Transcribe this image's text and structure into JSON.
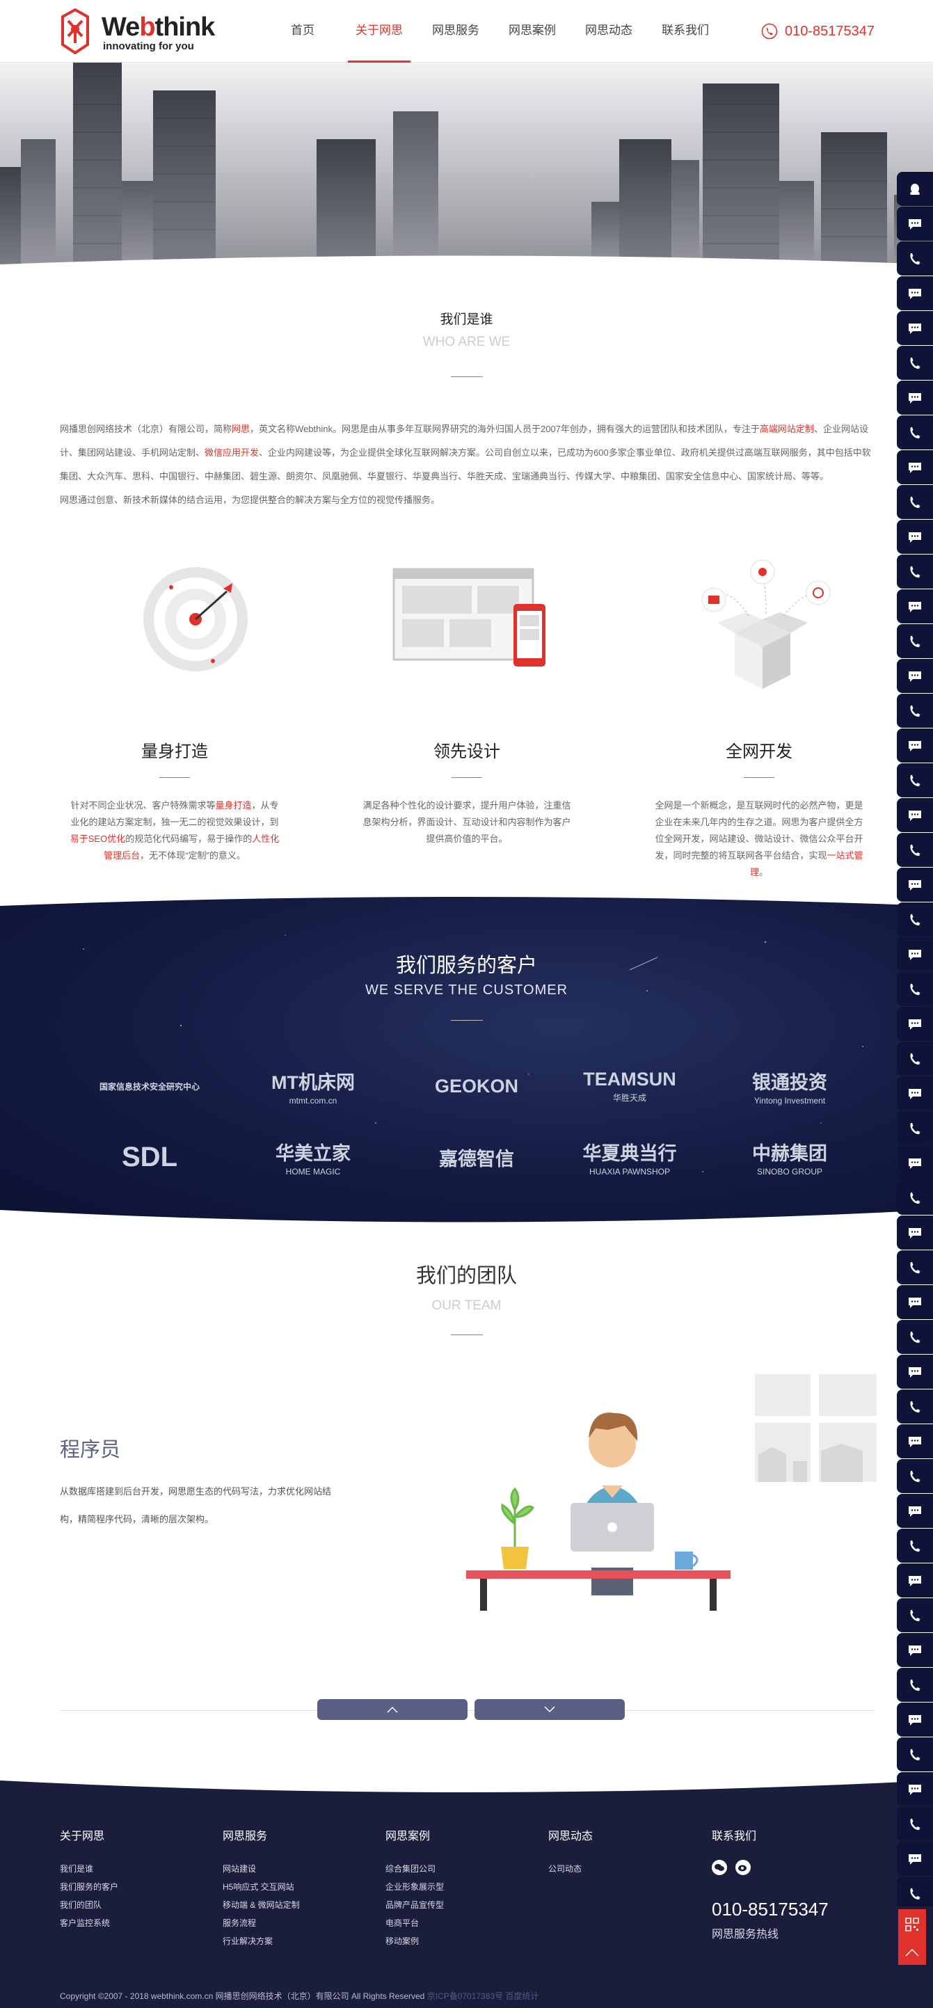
{
  "header": {
    "logo_name": "Webthink",
    "logo_slogan": "innovating for you",
    "nav": [
      "首页",
      "关于网思",
      "网思服务",
      "网思案例",
      "网思动态",
      "联系我们"
    ],
    "active_nav_index": 1,
    "phone": "010-85175347"
  },
  "who": {
    "title_cn": "我们是谁",
    "title_en": "WHO ARE WE",
    "para1": [
      {
        "t": "网播思创网络技术（北京）有限公司，简称"
      },
      {
        "t": "网思",
        "hl": true
      },
      {
        "t": "，英文名称Webthink。网思是由从事多年互联网界研究的海外归国人员于2007年创办，拥有强大的运营团队和技术团队，专注于"
      },
      {
        "t": "高端网站定制",
        "hl": true
      },
      {
        "t": "、企业网站设计、集团网站建设、手机网站定制、"
      },
      {
        "t": "微信应用开发",
        "hl": true
      },
      {
        "t": "、企业内网建设等，为企业提供全球化互联网解决方案。公司自创立以来，已成功为600多家企事业单位、政府机关提供过高端互联网服务，其中包括中软集团、大众汽车、思科、中国银行、中赫集团、碧生源、朗资尔、凤凰驰佩、华夏银行、华夏典当行、华胜天成、宝瑞通典当行、传媒大学、中粮集团、国家安全信息中心、国家统计局、等等。"
      }
    ],
    "para2": "网思通过创意、新技术新媒体的结合运用，为您提供整合的解决方案与全方位的视觉传播服务。"
  },
  "features": [
    {
      "title": "量身打造",
      "desc": [
        {
          "t": "针对不同企业状况、客户特殊需求等"
        },
        {
          "t": "量身打造",
          "hl": true
        },
        {
          "t": "，从专业化的建站方案定制，独一无二的视觉效果设计，到"
        },
        {
          "t": "易于SEO优化",
          "hl": true
        },
        {
          "t": "的规范化代码编写，易于操作的"
        },
        {
          "t": "人性化管理后台",
          "hl": true
        },
        {
          "t": "，无不体现“定制”的意义。"
        }
      ]
    },
    {
      "title": "领先设计",
      "desc": [
        {
          "t": "满足各种个性化的设计要求，提升用户体验，注重信息架构分析，界面设计、互动设计和内容制作为客户提供高价值的平台。"
        }
      ]
    },
    {
      "title": "全网开发",
      "desc": [
        {
          "t": "全网是一个新概念，是互联网时代的必然产物，更是企业在未来几年内的生存之道。网思为客户提供全方位全网开发，网站建设、微站设计、微信公众平台开发，同时完整的将互联网各平台结合，实现"
        },
        {
          "t": "一站式管理",
          "hl": true
        },
        {
          "t": "。"
        }
      ]
    }
  ],
  "clients": {
    "title_cn": "我们服务的客户",
    "title_en": "WE SERVE THE CUSTOMER",
    "logos": [
      {
        "name": "国家信息技术安全研究中心"
      },
      {
        "name": "MT机床网",
        "sub": "mtmt.com.cn"
      },
      {
        "name": "GEOKON"
      },
      {
        "name": "TEAMSUN",
        "sub": "华胜天成"
      },
      {
        "name": "银通投资",
        "sub": "Yintong Investment"
      },
      {
        "name": "SDL"
      },
      {
        "name": "华美立家",
        "sub": "HOME MAGIC"
      },
      {
        "name": "嘉德智信"
      },
      {
        "name": "华夏典当行",
        "sub": "HUAXIA PAWNSHOP"
      },
      {
        "name": "中赫集团",
        "sub": "SINOBO GROUP"
      }
    ]
  },
  "team": {
    "title_cn": "我们的团队",
    "title_en": "OUR TEAM",
    "role": "程序员",
    "role_desc": "从数据库搭建到后台开发，网思愿生态的代码写法，力求优化网站结构，精简程序代码，清晰的层次架构。"
  },
  "footer": {
    "columns": [
      {
        "heading": "关于网思",
        "links": [
          "我们是谁",
          "我们服务的客户",
          "我们的团队",
          "客户监控系统"
        ]
      },
      {
        "heading": "网思服务",
        "links": [
          "网站建设",
          "H5响应式 交互网站",
          "移动端 & 微网站定制",
          "服务流程",
          "行业解决方案"
        ]
      },
      {
        "heading": "网思案例",
        "links": [
          "综合集团公司",
          "企业形象展示型",
          "品牌产品宣传型",
          "电商平台",
          "移动案例"
        ]
      },
      {
        "heading": "网思动态",
        "links": [
          "公司动态"
        ]
      }
    ],
    "contact_heading": "联系我们",
    "phone": "010-85175347",
    "phone_label": "网思服务热线",
    "copyright": "Copyright ©2007 - 2018 webthink.com.cn 网播思创网络技术（北京）有限公司 All Rights Reserved",
    "icp": "京ICP备07017383号 百度统计"
  },
  "floatbar": {
    "icons": [
      "qq-icon",
      "message-icon",
      "phone-icon",
      "message-icon",
      "message-icon",
      "phone-icon",
      "message-icon",
      "phone-icon",
      "message-icon",
      "phone-icon",
      "message-icon",
      "phone-icon",
      "message-icon",
      "phone-icon",
      "message-icon",
      "phone-icon",
      "message-icon",
      "phone-icon",
      "message-icon",
      "phone-icon",
      "message-icon",
      "phone-icon",
      "message-icon",
      "phone-icon",
      "message-icon",
      "phone-icon",
      "message-icon",
      "phone-icon",
      "message-icon",
      "phone-icon",
      "message-icon",
      "phone-icon",
      "message-icon",
      "phone-icon",
      "message-icon",
      "phone-icon",
      "message-icon",
      "phone-icon",
      "message-icon",
      "phone-icon",
      "message-icon",
      "phone-icon",
      "message-icon",
      "phone-icon",
      "message-icon",
      "phone-icon",
      "message-icon",
      "phone-icon",
      "message-icon",
      "phone-icon",
      "message-icon",
      "phone-icon",
      "message-icon",
      "phone-icon"
    ]
  },
  "colors": {
    "accent": "#e0322b",
    "navy": "#1b1d3d",
    "team_purple": "#5b5f84"
  }
}
